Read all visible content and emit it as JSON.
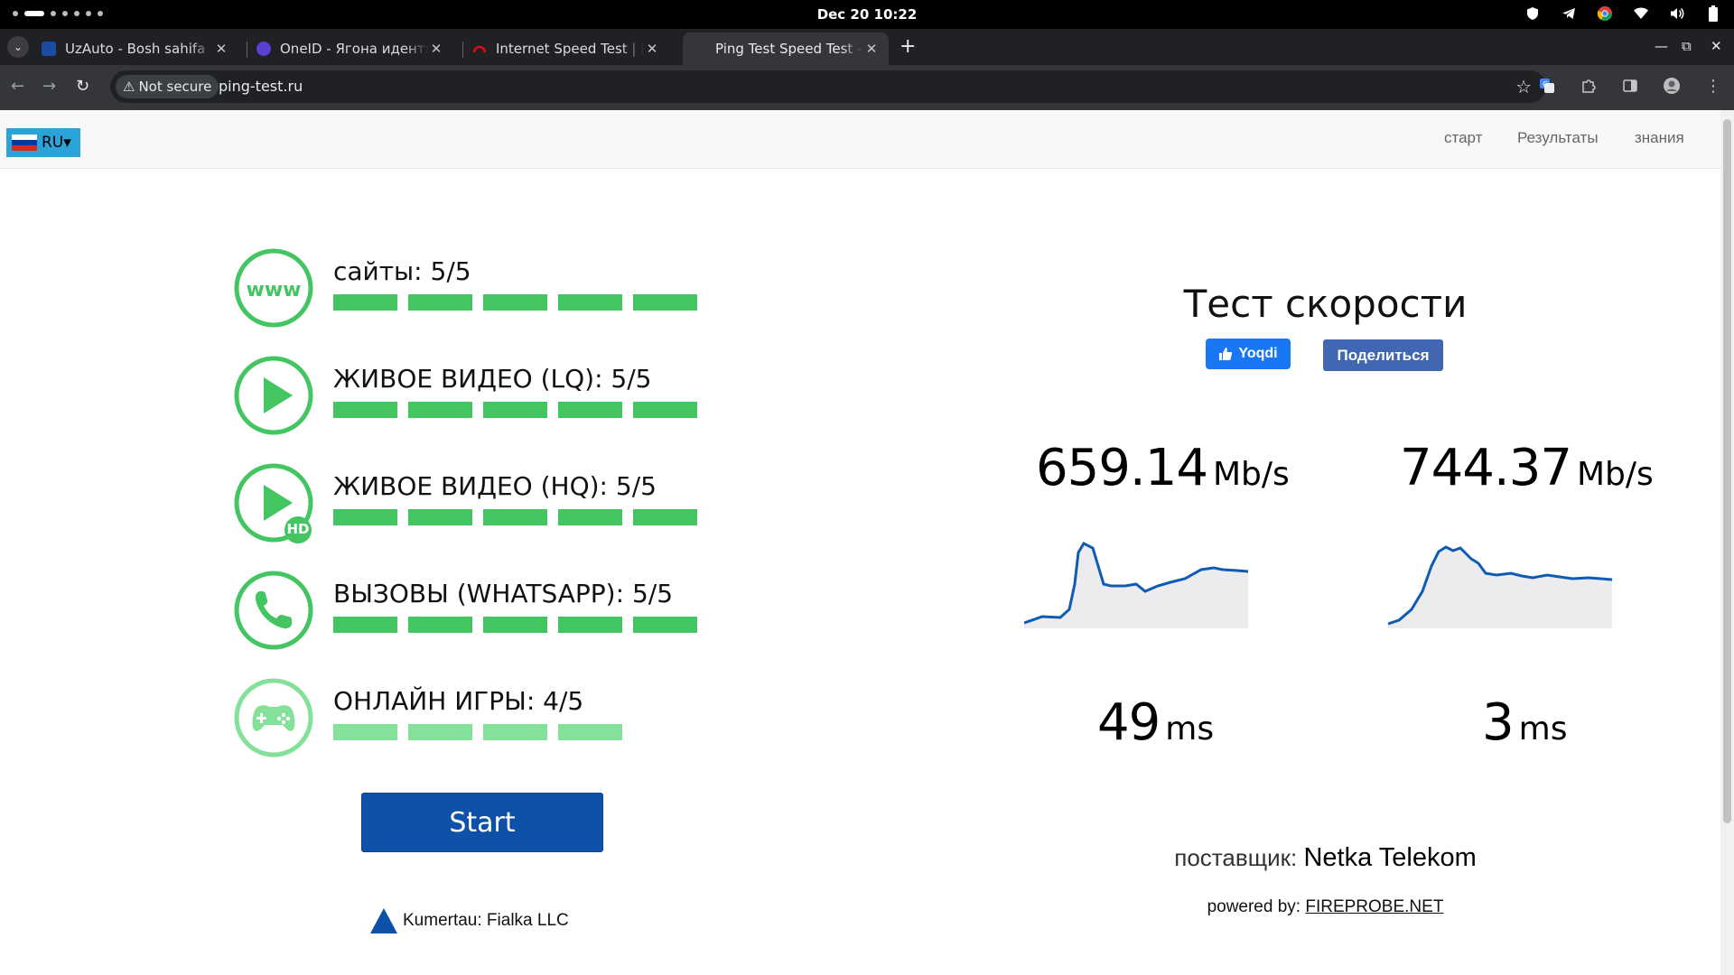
{
  "os": {
    "date": "Dec 20",
    "time": "10:22"
  },
  "tabs": [
    {
      "title": "UzAuto - Bosh sahifa",
      "favicon_color": "#1a4da1",
      "active": false
    },
    {
      "title": "OneID - Ягона идентификация",
      "favicon_color": "#5b3fd1",
      "active": false
    },
    {
      "title": "Internet Speed Test | Fast.com",
      "favicon_color": "#e50914",
      "active": false
    },
    {
      "title": "Ping Test Speed Test - ping-test.ru",
      "favicon_color": "#35363a",
      "active": true
    }
  ],
  "address_bar": {
    "security_label": "Not secure",
    "url": "ping-test.ru"
  },
  "site_nav": {
    "language": "RU▾",
    "links": [
      "старт",
      "Результаты",
      "знания"
    ]
  },
  "quality": [
    {
      "icon": "www-icon",
      "label": "сайты: 5/5",
      "score": 5,
      "max": 5
    },
    {
      "icon": "play-icon",
      "label": "ЖИВОЕ ВИДЕО (LQ): 5/5",
      "score": 5,
      "max": 5
    },
    {
      "icon": "play-hd-icon",
      "label": "ЖИВОЕ ВИДЕО (HQ): 5/5",
      "score": 5,
      "max": 5,
      "badge": "HD"
    },
    {
      "icon": "phone-icon",
      "label": "ВЫЗОВЫ (WHATSAPP): 5/5",
      "score": 5,
      "max": 5
    },
    {
      "icon": "gamepad-icon",
      "label": "ОНЛАЙН ИГРЫ: 4/5",
      "score": 4,
      "max": 5
    }
  ],
  "start_button": "Start",
  "location": "Kumertau: Fialka LLC",
  "speed_panel": {
    "title": "Тест скорости",
    "like_button": "Yoqdi",
    "share_button": "Поделиться",
    "download": {
      "value": "659.14",
      "unit": "Mb/s"
    },
    "upload": {
      "value": "744.37",
      "unit": "Mb/s"
    },
    "ping": {
      "value": "49",
      "unit": "ms"
    },
    "jitter": {
      "value": "3",
      "unit": "ms"
    },
    "provider_label": "поставщик:",
    "provider_name": "Netka Telekom",
    "powered_label": "powered by:",
    "powered_link": "FIREPROBE.NET"
  },
  "colors": {
    "good": "#43c562",
    "fair": "#83e199",
    "start": "#0d52a8",
    "line": "#0e5bb5"
  }
}
